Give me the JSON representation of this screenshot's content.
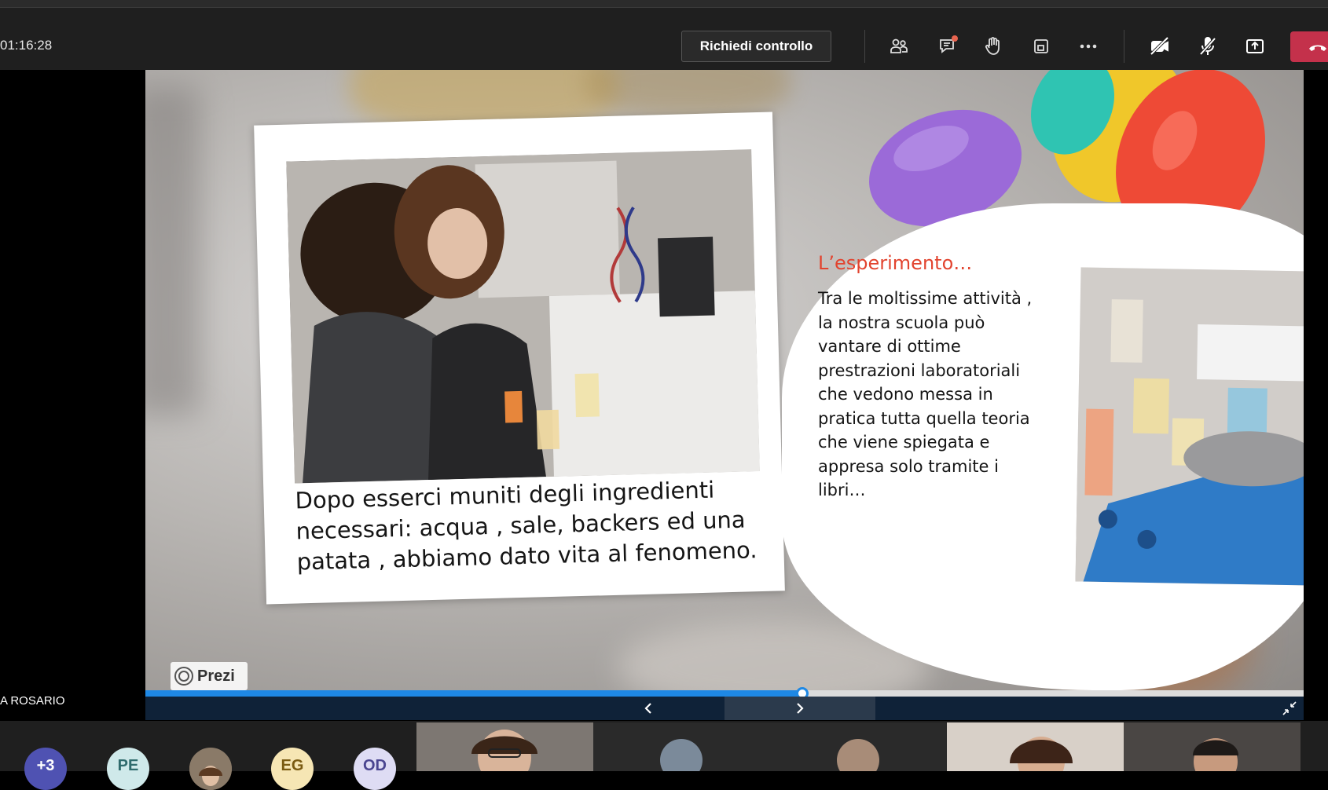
{
  "call": {
    "timer": "01:16:28",
    "request_control_label": "Richiedi controllo",
    "icons": [
      "participants-icon",
      "chat-icon",
      "raise-hand-icon",
      "layout-icon",
      "more-icon",
      "camera-off-icon",
      "mic-off-icon",
      "share-tray-icon",
      "hang-up-icon"
    ],
    "presenter_name": "A ROSARIO"
  },
  "slide": {
    "left_card_text": "Dopo esserci muniti degli ingredienti necessari: acqua , sale, backers ed una patata , abbiamo dato vita al fenomeno.",
    "right_title": "L’esperimento…",
    "right_body": "Tra le moltissime attività , la nostra scuola può vantare di ottime prestrazioni laboratoriali che vedono messa in pratica tutta quella teoria che viene spiegata e appresa solo tramite i libri…",
    "watermark": "Prezi"
  },
  "presentation_controls": {
    "progress": 0.567,
    "prev_icon": "chevron-left-icon",
    "next_icon": "chevron-right-icon",
    "fullscreen_icon": "exit-fullscreen-icon"
  },
  "participants": {
    "avatars": [
      {
        "initials": "+3",
        "bg": "#4f52b2",
        "fg": "#ffffff"
      },
      {
        "initials": "PE",
        "bg": "#cfe9ea",
        "fg": "#2f6b6d"
      },
      {
        "initials": "",
        "bg": "#8a7a68",
        "fg": "#ffffff"
      },
      {
        "initials": "EG",
        "bg": "#f6e6b4",
        "fg": "#7a5b12"
      },
      {
        "initials": "OD",
        "bg": "#dedcf4",
        "fg": "#4a4590"
      }
    ]
  },
  "colors": {
    "accent_blue": "#1e88e5",
    "hangup_red": "#c4314b",
    "slide_title_red": "#e2442f",
    "notification_dot": "#e8644f"
  }
}
